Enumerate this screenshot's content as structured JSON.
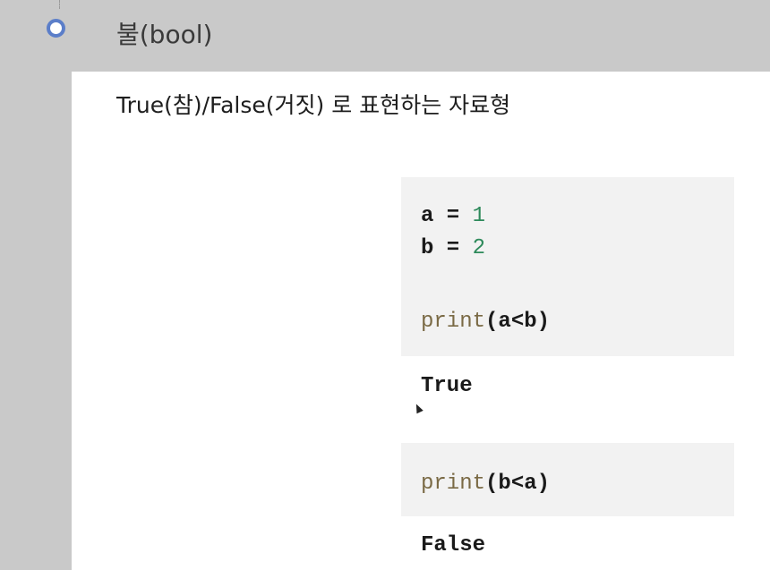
{
  "section": {
    "bullet_icon": "circle-bullet-icon",
    "title": "불(bool)"
  },
  "description": "True(참)/False(거짓) 로 표현하는 자료형",
  "cells": [
    {
      "lines": [
        {
          "var": "a",
          "op": " = ",
          "num": "1"
        },
        {
          "var": "b",
          "op": " = ",
          "num": "2"
        },
        {
          "fn": "print",
          "args": "(a<b)"
        }
      ],
      "output": "True"
    },
    {
      "lines": [
        {
          "fn": "print",
          "args": "(b<a)"
        }
      ],
      "output": "False"
    }
  ],
  "colors": {
    "bullet": "#5b7ec9",
    "number": "#2e8a5b",
    "function": "#7a6a45",
    "cell_bg": "#f2f2f2"
  }
}
